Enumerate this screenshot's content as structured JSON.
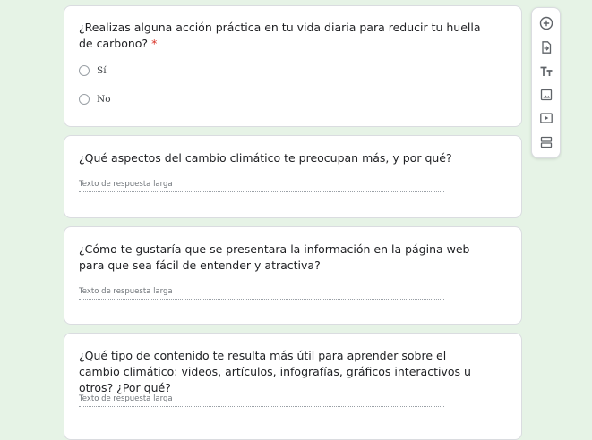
{
  "questions": [
    {
      "title": "¿Realizas alguna acción práctica en tu vida diaria para reducir tu huella de carbono?",
      "required_mark": "*",
      "options": [
        "Sí",
        "No"
      ]
    },
    {
      "title": "¿Qué aspectos del cambio climático te preocupan más, y por qué?",
      "placeholder": "Texto de respuesta larga"
    },
    {
      "title": "¿Cómo te gustaría que se presentara la información en la página web para que sea fácil de entender y atractiva?",
      "placeholder": "Texto de respuesta larga"
    },
    {
      "title": "¿Qué tipo de contenido te resulta más útil para aprender sobre el cambio climático: videos, artículos, infografías, gráficos interactivos u otros? ¿Por qué?",
      "placeholder": "Texto de respuesta larga"
    }
  ],
  "toolbar": {
    "icons": [
      "add-question-icon",
      "import-questions-icon",
      "add-title-icon",
      "add-image-icon",
      "add-video-icon",
      "add-section-icon"
    ]
  },
  "colors": {
    "background": "#e6f3e6",
    "required": "#d93025",
    "card_border": "#dadce0"
  }
}
